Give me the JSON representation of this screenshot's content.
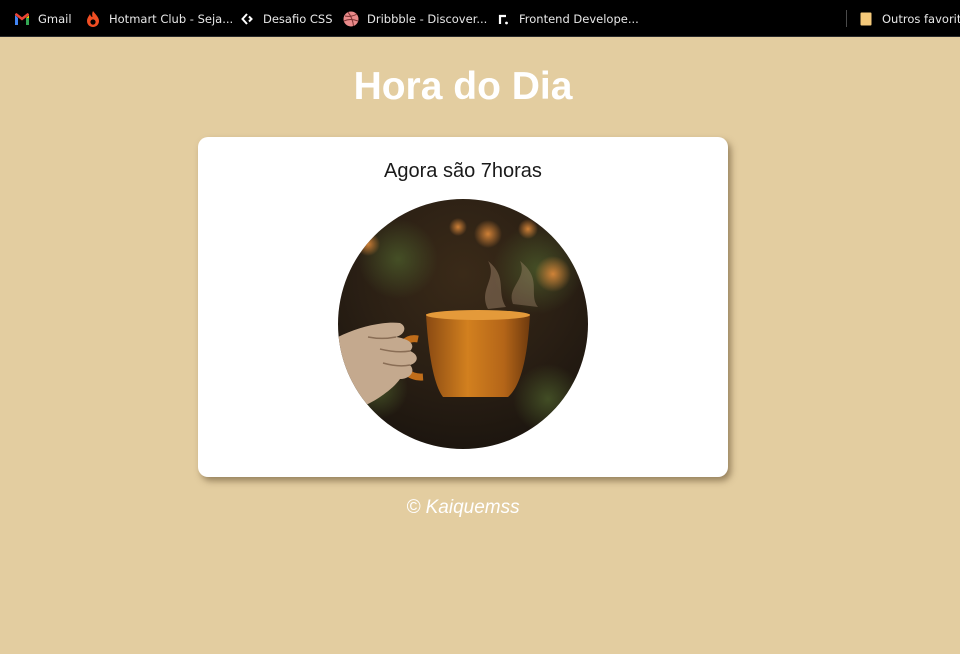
{
  "bookmarks": {
    "items": [
      {
        "label": "Gmail",
        "icon": "gmail-icon"
      },
      {
        "label": "Hotmart Club - Seja...",
        "icon": "hotmart-icon"
      },
      {
        "label": "Desafio CSS",
        "icon": "desafio-icon"
      },
      {
        "label": "Dribbble - Discover...",
        "icon": "dribbble-icon"
      },
      {
        "label": "Frontend Develope...",
        "icon": "frontend-mentor-icon"
      }
    ],
    "other": {
      "label": "Outros favoritos",
      "icon": "folder-icon"
    }
  },
  "page": {
    "title": "Hora do Dia",
    "time_message": "Agora são 7horas",
    "footer": "© Kaiquemss"
  },
  "colors": {
    "background": "#e3cda0",
    "card": "#ffffff",
    "title": "#ffffff",
    "bookmarks_bar": "#000000"
  }
}
